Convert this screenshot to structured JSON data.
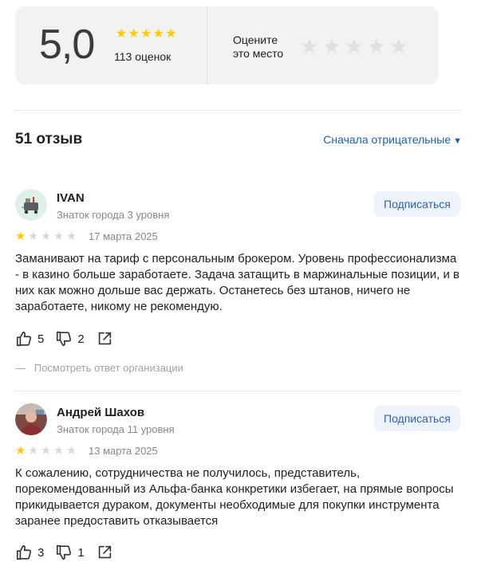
{
  "summary": {
    "score": "5,0",
    "ratings_count": "113 оценок",
    "score_star_color": "#ffcc00",
    "rate_prompt": "Оцените это место"
  },
  "reviews_header": {
    "title": "51 отзыв",
    "sort_label": "Сначала отрицательные",
    "sort_caret": "▼"
  },
  "reviews": [
    {
      "author": "IVAN",
      "level": "Знаток города 3 уровня",
      "subscribe_label": "Подписаться",
      "rating": 1,
      "date": "17 марта 2025",
      "text": "Заманивают на тариф с персональным брокером. Уровень профессионализма - в казино больше заработаете. Задача затащить в маржинальные позиции, и в них как можно дольше вас держать. Останетесь без штанов, ничего не заработаете, никому не рекомендую.",
      "likes": "5",
      "dislikes": "2",
      "org_answer_link": "Посмотреть ответ организации",
      "avatar_icon": "robot-cart-icon"
    },
    {
      "author": "Андрей Шахов",
      "level": "Знаток города 11 уровня",
      "subscribe_label": "Подписаться",
      "rating": 1,
      "date": "13 марта 2025",
      "text": "К сожалению, сотрудничества не получилось, представитель, порекомендованный из Альфа-банка конкретики избегает, на прямые вопросы прикидывается дураком, документы необходимые для покупки инструмента заранее предоставить отказывается",
      "likes": "3",
      "dislikes": "1",
      "avatar_icon": "user-photo"
    }
  ]
}
